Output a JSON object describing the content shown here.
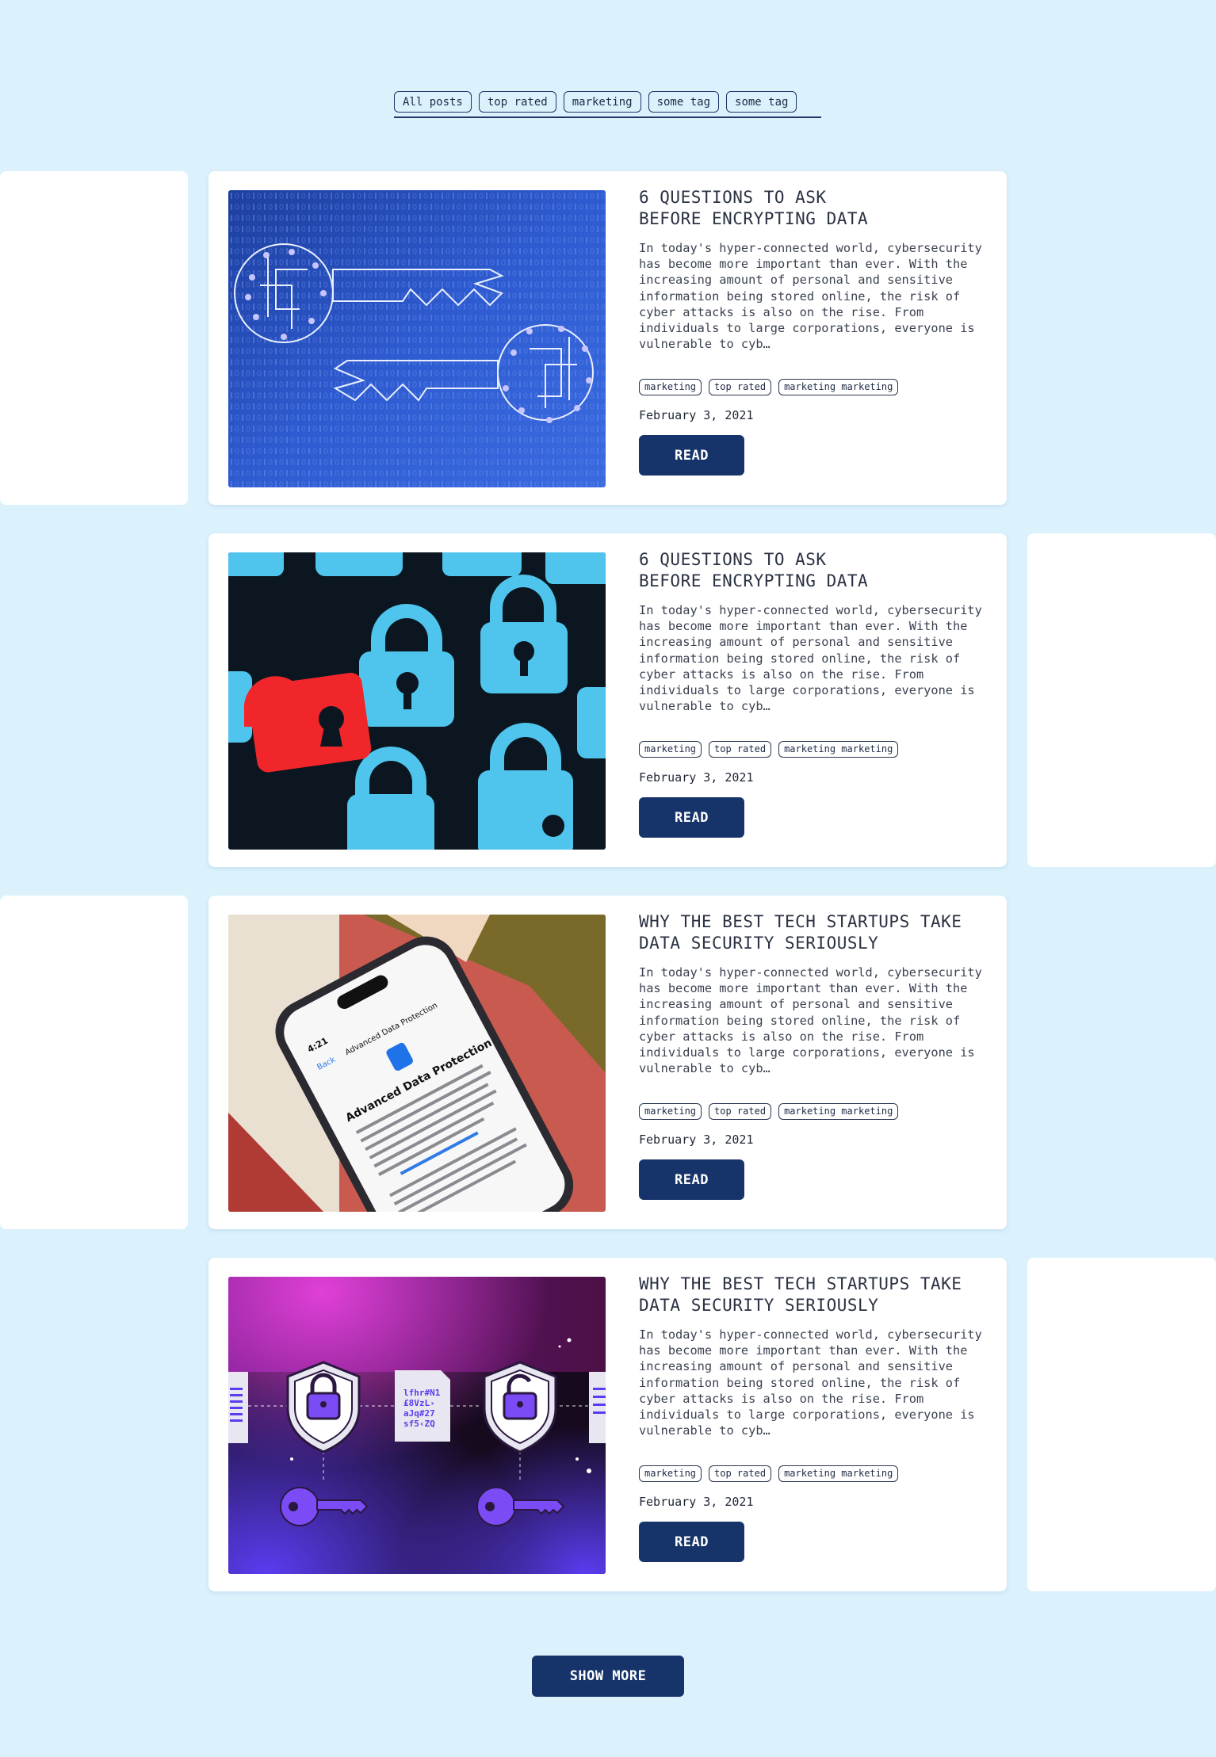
{
  "filters": [
    "All posts",
    "top rated",
    "marketing",
    "some tag",
    "some tag"
  ],
  "posts": [
    {
      "title_line1": "6 QUESTIONS TO ASK",
      "title_line2": "BEFORE ENCRYPTING DATA",
      "excerpt": "In today's hyper-connected world, cybersecurity has become more important than ever. With the increasing amount of personal and sensitive information being stored online, the risk of cyber attacks is also on the rise. From individuals to large corporations, everyone is vulnerable to cyb…",
      "tags": [
        "marketing",
        "top rated",
        "marketing marketing"
      ],
      "date": "February 3, 2021",
      "read_label": "READ",
      "image": "digital-keys-image"
    },
    {
      "title_line1": "6 QUESTIONS TO ASK",
      "title_line2": "BEFORE ENCRYPTING DATA",
      "excerpt": "In today's hyper-connected world, cybersecurity has become more important than ever. With the increasing amount of personal and sensitive information being stored online, the risk of cyber attacks is also on the rise. From individuals to large corporations, everyone is vulnerable to cyb…",
      "tags": [
        "marketing",
        "top rated",
        "marketing marketing"
      ],
      "date": "February 3, 2021",
      "read_label": "READ",
      "image": "padlocks-image"
    },
    {
      "title_line1": "WHY THE BEST TECH STARTUPS TAKE",
      "title_line2": "DATA SECURITY SERIOUSLY",
      "excerpt": "In today's hyper-connected world, cybersecurity has become more important than ever. With the increasing amount of personal and sensitive information being stored online, the risk of cyber attacks is also on the rise. From individuals to large corporations, everyone is vulnerable to cyb…",
      "tags": [
        "marketing",
        "top rated",
        "marketing marketing"
      ],
      "date": "February 3, 2021",
      "read_label": "READ",
      "image": "phone-data-protection-image",
      "image_text": {
        "time": "4:21",
        "back": "Back",
        "nav_title": "Advanced Data Protection",
        "heading": "Advanced Data Protection"
      }
    },
    {
      "title_line1": "WHY THE BEST TECH STARTUPS TAKE",
      "title_line2": "DATA SECURITY SERIOUSLY",
      "excerpt": "In today's hyper-connected world, cybersecurity has become more important than ever. With the increasing amount of personal and sensitive information being stored online, the risk of cyber attacks is also on the rise. From individuals to large corporations, everyone is vulnerable to cyb…",
      "tags": [
        "marketing",
        "top rated",
        "marketing marketing"
      ],
      "date": "February 3, 2021",
      "read_label": "READ",
      "image": "encryption-illustration-image",
      "image_text": {
        "cipher_lines": [
          "lfhr#N1",
          "£8VzL›",
          "aJq#27",
          "sf5‹ZQ"
        ]
      }
    }
  ],
  "show_more_label": "SHOW MORE",
  "colors": {
    "background": "#dbf2fd",
    "button": "#17346a",
    "card": "#ffffff"
  }
}
